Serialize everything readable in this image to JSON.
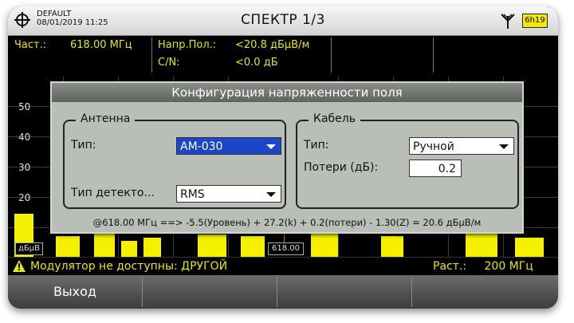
{
  "header": {
    "profile": "DEFAULT",
    "datetime": "08/01/2019 11:25",
    "title": "СПЕКТР 1/3",
    "battery": "6h19"
  },
  "info": {
    "freq_label": "Част.:",
    "freq_value": "618.00 МГц",
    "level_label": "Напр.Пол.:",
    "level_value": "<20.8 дБµВ/м",
    "cn_label": "C/N:",
    "cn_value": "<0.0 дБ"
  },
  "spectrum": {
    "y_ticks": [
      "50",
      "40",
      "30",
      "20"
    ],
    "unit": "дБµВ",
    "marker_label": "618.00",
    "trace_color": "#f4f000",
    "marker_color": "#ff3b3b"
  },
  "dialog": {
    "title": "Конфигурация напряженности поля",
    "antenna": {
      "legend": "Антенна",
      "type_label": "Тип:",
      "type_value": "AM-030",
      "detector_label": "Тип детекто...",
      "detector_value": "RMS"
    },
    "cable": {
      "legend": "Кабель",
      "type_label": "Тип:",
      "type_value": "Ручной",
      "loss_label": "Потери (дБ):",
      "loss_value": "0.2"
    },
    "formula": "@618.00 МГц ==> -5.5(Уровень) + 27.2(k) + 0.2(потери) - 1.30(Z) = 20.6 дБµВ/м"
  },
  "status": {
    "warning": "Модулятор не доступны: ДРУГОЙ",
    "span_label": "Раст.:",
    "span_value": "200 МГц"
  },
  "softkeys": [
    "Выход",
    "",
    "",
    "",
    ""
  ],
  "colors": {
    "accent_yellow": "#e7e800",
    "dialog_bg": "#b9beb7",
    "selected_blue": "#1c46c9"
  }
}
